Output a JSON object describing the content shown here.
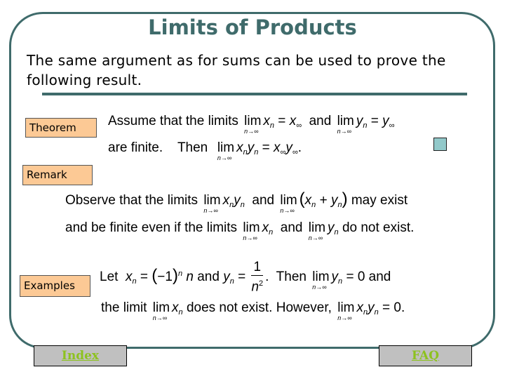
{
  "title": "Limits of Products",
  "intro": "The same argument as for sums can be used to prove the following result.",
  "sections": {
    "theorem": {
      "label": "Theorem",
      "line1_prefix": "Assume that the limits",
      "line1_and": "and",
      "line2_prefix": "are finite.",
      "line2_then": "Then"
    },
    "remark": {
      "label": "Remark",
      "line1_prefix": "Observe that the limits",
      "line1_and": "and",
      "line1_suffix": "may exist",
      "line2_prefix": "and  be finite even if the limits",
      "line2_and": "and",
      "line2_suffix": "do not exist."
    },
    "examples": {
      "label": "Examples",
      "line1_prefix": "Let",
      "line1_and": "and",
      "line1_then": "Then",
      "line1_suffix": "and",
      "line2_prefix": "the limit",
      "line2_mid": "does not exist.  However,"
    }
  },
  "math": {
    "lim": "lim",
    "sub": "n→∞",
    "x": "x",
    "y": "y",
    "n": "n",
    "inf": "∞",
    "eq_zero": "= 0",
    "eq_zero_dot": "= 0.",
    "neg_one": "(−1)",
    "one": "1",
    "n2": "n²"
  },
  "nav": {
    "index_label": "Index",
    "faq_label": "FAQ"
  },
  "colors": {
    "accent": "#3f6b6b",
    "tag_bg": "#fcc995",
    "nav_bg": "#c0c0c0",
    "nav_text": "#8dc21f",
    "qed": "#92c9ca"
  }
}
